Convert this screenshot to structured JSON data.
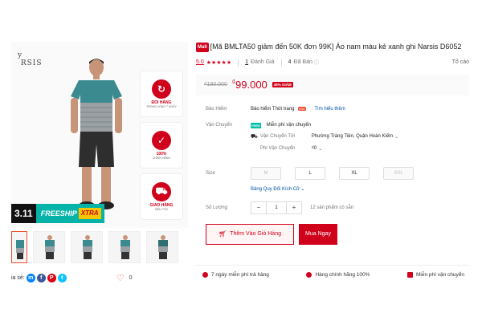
{
  "gallery": {
    "brand_mark": "y\nRSIS",
    "badges": [
      {
        "icon": "refresh-icon",
        "title": "ĐỔI HÀNG",
        "sub": "TRONG VÒNG 7 NGÀY"
      },
      {
        "icon": "check-icon",
        "title": "100%",
        "sub": "CHÍNH HÃNG"
      },
      {
        "icon": "truck-icon",
        "title": "GIAO HÀNG",
        "sub": "SIÊU TỐC"
      }
    ],
    "promo_date": "3.11",
    "promo_freeship": "FREESHIP",
    "promo_xtra": "XTRA",
    "share_label": "ia sẻ:",
    "like_count": "0"
  },
  "product": {
    "mall_badge": "Mall",
    "title": "[Mã BMLTA50 giảm đến 50K đơn 99K] Áo nam màu kẻ xanh ghi Narsis D6052",
    "rating": "5.0",
    "stars": "★★★★★",
    "review_count": "1",
    "review_label": "Đánh Giá",
    "sold_count": "4",
    "sold_label": "Đã Bán",
    "report": "Tố cáo",
    "old_price": "₫180.000",
    "currency": "₫",
    "new_price": "99.000",
    "discount": "45% GIẢM"
  },
  "insurance": {
    "label": "Bảo Hiểm",
    "text": "Bảo hiểm Thời trang",
    "badge": "Mới",
    "link": "Tìm hiểu thêm"
  },
  "shipping": {
    "label": "Vận Chuyển",
    "free_tag": "FREE",
    "free_text": "Miễn phí vận chuyển",
    "to_label": "Vận Chuyển Tới",
    "to_value": "Phường Tràng Tiền, Quận Hoàn Kiếm",
    "fee_label": "Phí Vận Chuyển",
    "fee_value": "₫0"
  },
  "size": {
    "label": "Size",
    "options": [
      {
        "label": "M",
        "disabled": true
      },
      {
        "label": "L",
        "disabled": false
      },
      {
        "label": "XL",
        "disabled": false
      },
      {
        "label": "XXL",
        "disabled": true
      }
    ],
    "guide": "Bảng Quy Đổi Kích Cỡ"
  },
  "quantity": {
    "label": "Số Lượng",
    "minus": "−",
    "value": "1",
    "plus": "+",
    "stock": "12 sản phẩm có sẵn"
  },
  "actions": {
    "add_to_cart": "Thêm Vào Giỏ Hàng",
    "buy_now": "Mua Ngay"
  },
  "guarantees": [
    "7 ngày miễn phí trả hàng",
    "Hàng chính hãng 100%",
    "Miễn phí vận chuyển"
  ],
  "colors": {
    "accent": "#d0011b",
    "teal": "#06b3a8"
  }
}
